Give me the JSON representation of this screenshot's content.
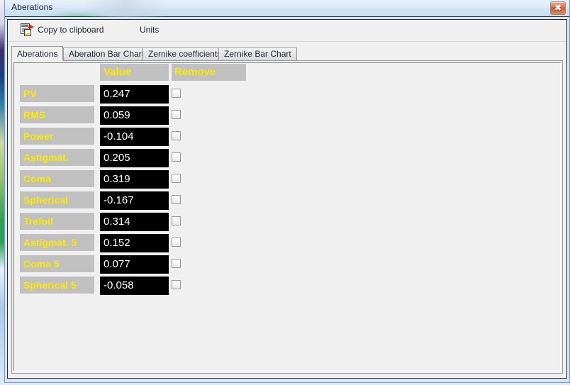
{
  "window": {
    "title": "Aberations",
    "close_label": "✖",
    "close_icon": "close-icon"
  },
  "toolbar": {
    "copy_label": "Copy to clipboard",
    "copy_icon": "copy-to-clipboard-icon",
    "units_label": "Units"
  },
  "tabs": [
    {
      "label": "Aberations",
      "active": true
    },
    {
      "label": "Aberation Bar Chart",
      "active": false
    },
    {
      "label": "Zernike coefficients",
      "active": false
    },
    {
      "label": "Zernike Bar Chart",
      "active": false
    }
  ],
  "grid": {
    "headers": {
      "name": "",
      "value": "Value",
      "remove": "Remove"
    },
    "rows": [
      {
        "name": "PV",
        "value": "0.247",
        "remove_checked": false
      },
      {
        "name": "RMS",
        "value": "0.059",
        "remove_checked": false
      },
      {
        "name": "Power",
        "value": "-0.104",
        "remove_checked": false
      },
      {
        "name": "Astigmat.",
        "value": "0.205",
        "remove_checked": false
      },
      {
        "name": "Coma",
        "value": "0.319",
        "remove_checked": false
      },
      {
        "name": "Spherical",
        "value": "-0.167",
        "remove_checked": false
      },
      {
        "name": "Trefoil",
        "value": "0.314",
        "remove_checked": false
      },
      {
        "name": "Astigmat. 5",
        "value": "0.152",
        "remove_checked": false
      },
      {
        "name": "Coma 5",
        "value": "0.077",
        "remove_checked": false
      },
      {
        "name": "Spherical 5",
        "value": "-0.058",
        "remove_checked": false
      }
    ]
  },
  "colors": {
    "label_bg": "#c0c0c0",
    "label_fg": "#ffe800",
    "value_bg": "#000000",
    "value_fg": "#ffffff",
    "titlebar": "#cfe2f5",
    "close_button": "#e4744a",
    "client_bg": "#f0f0f0"
  }
}
